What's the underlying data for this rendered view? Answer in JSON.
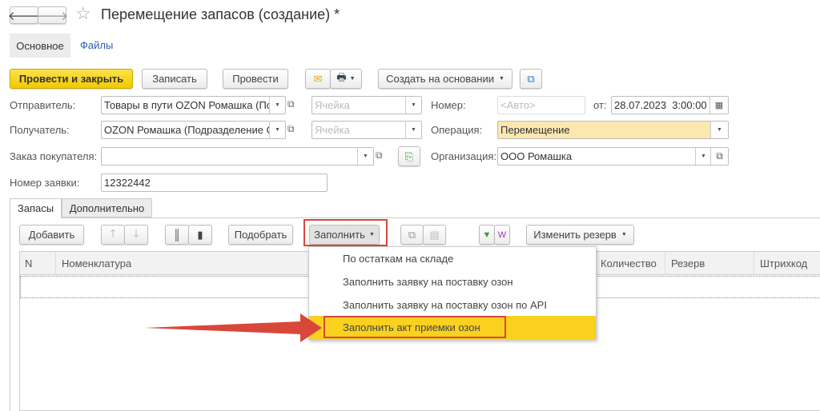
{
  "window": {
    "title": "Перемещение запасов (создание) *"
  },
  "form_tabs": [
    {
      "label": "Основное"
    },
    {
      "label": "Файлы"
    }
  ],
  "toolbar": {
    "post_close": "Провести и закрыть",
    "save": "Записать",
    "post": "Провести",
    "create_based": "Создать на основании"
  },
  "fields": {
    "sender": {
      "label": "Отправитель:",
      "value": "Товары в пути OZON Ромашка (По,"
    },
    "sender_cell": {
      "placeholder": "Ячейка"
    },
    "receiver": {
      "label": "Получатель:",
      "value": "OZON Ромашка (Подразделение О"
    },
    "receiver_cell": {
      "placeholder": "Ячейка"
    },
    "order": {
      "label": "Заказ покупателя:",
      "value": ""
    },
    "request": {
      "label": "Номер заявки:",
      "value": "12322442"
    },
    "number": {
      "label": "Номер:",
      "placeholder": "<Авто>"
    },
    "date": {
      "label": "от:",
      "value": "28.07.2023  3:00:00"
    },
    "operation": {
      "label": "Операция:",
      "value": "Перемещение"
    },
    "organization": {
      "label": "Организация:",
      "value": "ООО Ромашка"
    }
  },
  "section_tabs": [
    {
      "label": "Запасы"
    },
    {
      "label": "Дополнительно"
    }
  ],
  "table_toolbar": {
    "add": "Добавить",
    "pick": "Подобрать",
    "fill": "Заполнить",
    "change_reserve": "Изменить резерв"
  },
  "table": {
    "columns": [
      "N",
      "Номенклатура",
      "Количество",
      "Резерв",
      "Штрихкод"
    ]
  },
  "fill_menu": {
    "items": [
      "По остаткам на складе",
      "Заполнить заявку на поставку озон",
      "Заполнить заявку на поставку озон по API",
      "Заполнить акт приемки озон"
    ],
    "highlighted": 3
  },
  "colors": {
    "primary_button": "#f6d21c",
    "highlight": "#f9d11e",
    "annotation": "#d9473b",
    "operation_field": "#fde7b0"
  }
}
